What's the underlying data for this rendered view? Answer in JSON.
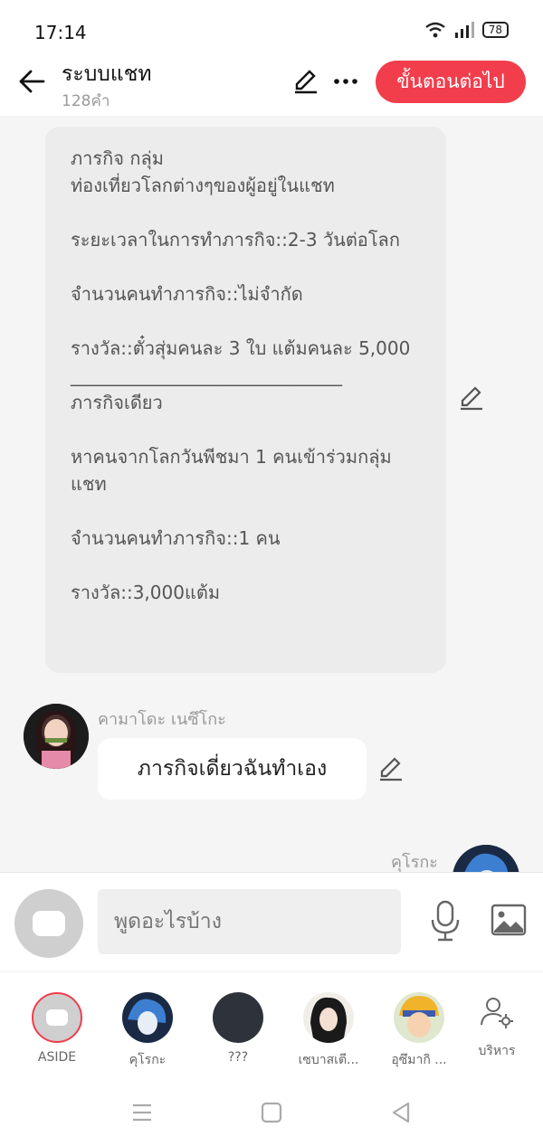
{
  "status": {
    "time": "17:14",
    "battery": "78"
  },
  "header": {
    "title": "ระบบแชท",
    "subtitle": "128คำ",
    "next_label": "ขั้นตอนต่อไป"
  },
  "system_message": "ภารกิจ กลุ่ม\nท่องเที่ยวโลกต่างๆของผู้อยู่ในแชท\n\nระยะเวลาในการทำภารกิจ::2-3 วันต่อโลก\n\nจำนวนคนทำภารกิจ::ไม่จำกัด\n\nรางวัล::ตั๋วสุ่มคนละ 3 ใบ แต้มคนละ 5,000\n______________________________\nภารกิจเดียว\n\nหาคนจากโลกวันพีชมา 1 คนเข้าร่วมกลุ่มแชท\n\nจำนวนคนทำภารกิจ::1 คน\n\nรางวัล::3,000แต้ม",
  "messages": [
    {
      "sender": "คามาโดะ เนซึโกะ",
      "text": "ภารกิจเดี่ยวฉันทำเอง"
    },
    {
      "sender": "คุโรกะ"
    }
  ],
  "composer": {
    "placeholder": "พูดอะไรบ้าง"
  },
  "tray": [
    {
      "label": "ASIDE",
      "color": "#cfcfcf"
    },
    {
      "label": "คุโรกะ",
      "color": "#1a2a44"
    },
    {
      "label": "???",
      "color": "#2e323b"
    },
    {
      "label": "เซบาสเตี...",
      "color": "#3a2a22"
    },
    {
      "label": "อุซึมากิ ...",
      "color": "#e9b24a"
    },
    {
      "label": "บริหาร",
      "color": "#ffffff"
    }
  ]
}
